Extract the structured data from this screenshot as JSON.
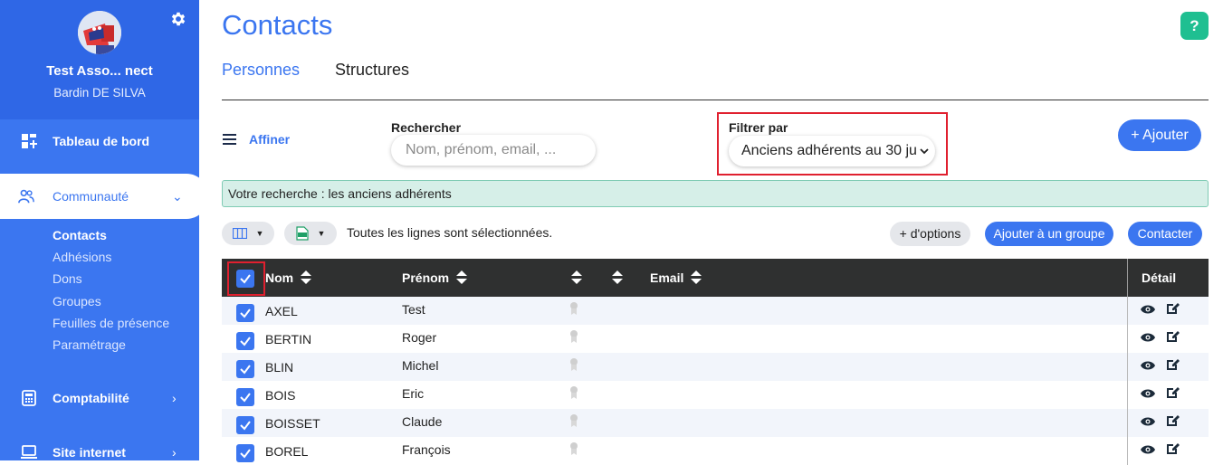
{
  "sidebar": {
    "org_name": "Test Asso... nect",
    "user_name": "Bardin DE SILVA",
    "items": [
      {
        "label": "Tableau de bord",
        "icon": "dashboard-icon"
      },
      {
        "label": "Communauté",
        "icon": "community-icon",
        "chevron": "⌄"
      },
      {
        "label": "Comptabilité",
        "icon": "calculator-icon",
        "chevron": "›"
      },
      {
        "label": "Site internet",
        "icon": "computer-icon",
        "chevron": "›"
      }
    ],
    "sub_items": [
      "Contacts",
      "Adhésions",
      "Dons",
      "Groupes",
      "Feuilles de présence",
      "Paramétrage"
    ]
  },
  "header": {
    "title": "Contacts",
    "help": "?"
  },
  "tabs": [
    "Personnes",
    "Structures"
  ],
  "toolbar": {
    "refine_label": "Affiner",
    "search_label": "Rechercher",
    "search_placeholder": "Nom, prénom, email, ...",
    "filter_label": "Filtrer par",
    "filter_value": "Anciens adhérents au 30 ju",
    "add_label": "+ Ajouter"
  },
  "banner": "Votre recherche : les anciens adhérents",
  "actions": {
    "selection_text": "Toutes les lignes sont sélectionnées.",
    "more_options": "+ d'options",
    "add_to_group": "Ajouter à un groupe",
    "contact": "Contacter"
  },
  "table": {
    "headers": {
      "nom": "Nom",
      "prenom": "Prénom",
      "email": "Email",
      "detail": "Détail"
    },
    "rows": [
      {
        "nom": "AXEL",
        "prenom": "Test"
      },
      {
        "nom": "BERTIN",
        "prenom": "Roger"
      },
      {
        "nom": "BLIN",
        "prenom": "Michel"
      },
      {
        "nom": "BOIS",
        "prenom": "Eric"
      },
      {
        "nom": "BOISSET",
        "prenom": "Claude"
      },
      {
        "nom": "BOREL",
        "prenom": "François"
      }
    ]
  },
  "colors": {
    "primary": "#3b76f0",
    "sidebar": "#3b76f0",
    "help": "#1fbf91",
    "highlight_border": "#e0202f",
    "banner_bg": "#d6efe8",
    "table_header": "#2f3030"
  }
}
